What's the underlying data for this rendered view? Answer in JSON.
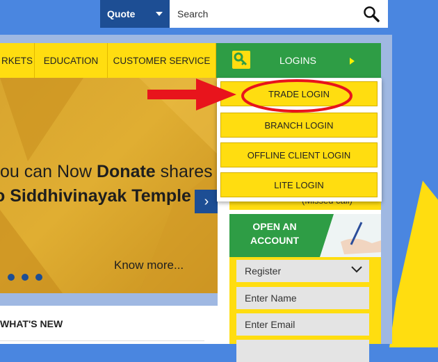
{
  "header": {
    "quote_label": "Quote",
    "search_placeholder": "Search"
  },
  "nav": {
    "items": [
      "RKETS",
      "EDUCATION",
      "CUSTOMER SERVICE"
    ],
    "logins_label": "LOGINS"
  },
  "logins_menu": {
    "items": [
      "TRADE LOGIN",
      "BRANCH LOGIN",
      "OFFLINE CLIENT LOGIN",
      "LITE LOGIN"
    ]
  },
  "banner": {
    "line1_prefix": "ou can Now ",
    "line1_bold": "Donate",
    "line1_suffix": " shares",
    "line2": "o Siddhivinayak Temple",
    "know_more": "Know more...",
    "next_symbol": "›"
  },
  "sidebar": {
    "missed_call": "(Missed call)",
    "open_account_line1": "OPEN AN",
    "open_account_line2": "ACCOUNT",
    "register_label": "Register",
    "name_placeholder": "Enter Name",
    "email_placeholder": "Enter Email"
  },
  "whats_new": {
    "title": "WHAT'S NEW"
  },
  "colors": {
    "brand_blue": "#1d4e94",
    "brand_yellow": "#ffdd10",
    "brand_green": "#2e9d45",
    "annotation_red": "#e8141c"
  },
  "icons": [
    "search-icon",
    "key-icon",
    "chevron-down-icon",
    "next-arrow-icon"
  ]
}
